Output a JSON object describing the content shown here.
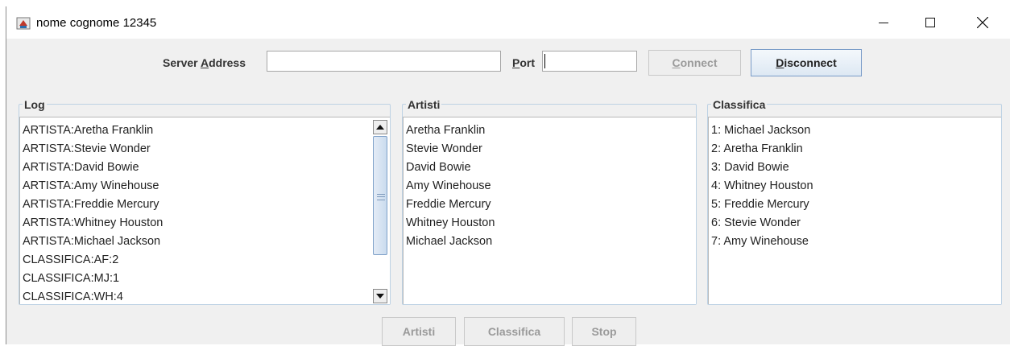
{
  "window": {
    "title": "nome cognome 12345",
    "icons": {
      "app": "java-cup-icon",
      "minimize": "minimize-icon",
      "maximize": "maximize-icon",
      "close": "close-icon"
    }
  },
  "connection": {
    "server_label_pre": "Server ",
    "server_label_mnemonic": "A",
    "server_label_post": "ddress",
    "server_value": "",
    "port_label_mnemonic": "P",
    "port_label_post": "ort",
    "port_value": "",
    "connect_mnemonic": "C",
    "connect_post": "onnect",
    "connect_enabled": false,
    "disconnect_mnemonic": "D",
    "disconnect_post": "isconnect",
    "disconnect_enabled": true
  },
  "panels": {
    "log": {
      "title": "Log",
      "items": [
        "ARTISTA:Aretha Franklin",
        "ARTISTA:Stevie Wonder",
        "ARTISTA:David Bowie",
        "ARTISTA:Amy Winehouse",
        "ARTISTA:Freddie Mercury",
        "ARTISTA:Whitney Houston",
        "ARTISTA:Michael Jackson",
        "CLASSIFICA:AF:2",
        "CLASSIFICA:MJ:1",
        "CLASSIFICA:WH:4"
      ]
    },
    "artisti": {
      "title": "Artisti",
      "items": [
        "Aretha Franklin",
        "Stevie Wonder",
        "David Bowie",
        "Amy Winehouse",
        "Freddie Mercury",
        "Whitney Houston",
        "Michael Jackson"
      ]
    },
    "classifica": {
      "title": "Classifica",
      "items": [
        "1: Michael Jackson",
        "2: Aretha Franklin",
        "3: David Bowie",
        "4: Whitney Houston",
        "5: Freddie Mercury",
        "6: Stevie Wonder",
        "7: Amy Winehouse"
      ]
    }
  },
  "actions": {
    "artisti": "Artisti",
    "classifica": "Classifica",
    "stop": "Stop",
    "enabled": false
  },
  "colors": {
    "accent_border": "#7a9cc8",
    "disabled_text": "#9a9a9a",
    "window_bg": "#f0f0f0"
  }
}
